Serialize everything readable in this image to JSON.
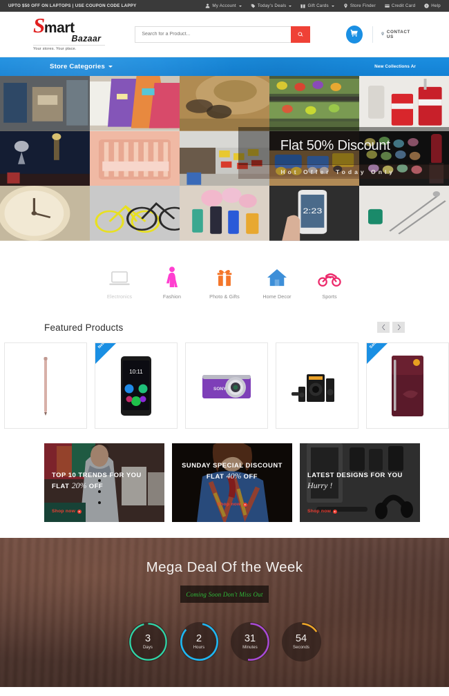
{
  "topbar": {
    "promo": "UPTO $50 OFF ON LAPTOPS | USE COUPON CODE LAPPY",
    "items": [
      {
        "label": "My Account",
        "icon": "user-icon",
        "caret": true
      },
      {
        "label": "Today's Deals",
        "icon": "tag-icon",
        "caret": true
      },
      {
        "label": "Gift Cards",
        "icon": "gift-icon",
        "caret": true
      },
      {
        "label": "Store Finder",
        "icon": "location-pin-icon",
        "caret": false
      },
      {
        "label": "Credit Card",
        "icon": "credit-card-icon",
        "caret": false
      },
      {
        "label": "Help",
        "icon": "help-circle-icon",
        "caret": false
      }
    ]
  },
  "header": {
    "logo": {
      "letter": "S",
      "main": "mart",
      "sub": "Bazaar",
      "tagline": "Your stores. Your place."
    },
    "search": {
      "placeholder": "Search for a Product...",
      "value": "",
      "button_icon": "search-icon"
    },
    "cart_icon": "shopping-cart-icon",
    "contact_label": "CONTACT US",
    "contact_icon": "location-pin-icon",
    "accent_red": "#ef4136",
    "accent_blue": "#1a8fe3"
  },
  "nav": {
    "store_categories": "Store Categories",
    "chevron_icon": "chevron-down-icon",
    "right_link": "New Collections Ar",
    "bg_color": "#1b8ee0"
  },
  "hero": {
    "title": "Flat 50% Discount",
    "subtitle": "Hot Offer Today Only",
    "tiles": [
      "storefront-photo",
      "handbags-photo",
      "sunglasses-hat-photo",
      "produce-shelf-photo",
      "cola-drink-photo",
      "jewelry-dark-photo",
      "baby-crib-photo",
      "supermarket-aisle-photo",
      "toy-train-photo",
      "makeup-palette-photo",
      "clock-photo",
      "bicycles-photo",
      "perfume-bottles-photo",
      "smartphone-hand-photo",
      "pens-desk-photo"
    ]
  },
  "categories": {
    "items": [
      {
        "label": "Electronics",
        "icon": "laptop-icon",
        "color": "#d2d2d2",
        "dim": true
      },
      {
        "label": "Fashion",
        "icon": "woman-dress-icon",
        "color": "#ff3fd0",
        "dim": false
      },
      {
        "label": "Photo & Gifts",
        "icon": "gift-box-icon",
        "color": "#f4762a",
        "dim": false
      },
      {
        "label": "Home Decor",
        "icon": "house-icon",
        "color": "#3d8fd8",
        "dim": false
      },
      {
        "label": "Sports",
        "icon": "motorcycle-icon",
        "color": "#ec2a6b",
        "dim": false
      }
    ]
  },
  "featured": {
    "title": "Featured Products",
    "prev_icon": "chevron-left-icon",
    "next_icon": "chevron-right-icon",
    "products": [
      {
        "name": "rose-gold-stylus",
        "badge": "",
        "image": "stylus-pen-product"
      },
      {
        "name": "black-smartphone",
        "badge": "New",
        "image": "smartphone-product"
      },
      {
        "name": "purple-sony-camera",
        "badge": "",
        "image": "camera-product"
      },
      {
        "name": "speaker-system",
        "badge": "",
        "image": "speakers-product"
      },
      {
        "name": "maroon-refrigerator",
        "badge": "Sale",
        "image": "refrigerator-product"
      }
    ],
    "badge_color": "#1a8fe3"
  },
  "promos": [
    {
      "name": "top-trends",
      "line1": "TOP 10 TRENDS FOR YOU",
      "line2_pre": "FLAT ",
      "line2_script": "20%",
      "line2_post": " OFF",
      "cta": "Shop now",
      "image": "woman-shopping-bags-photo"
    },
    {
      "name": "sunday-special",
      "line1": "SUNDAY SPECIAL DISCOUNT",
      "line2_pre": "FLAT ",
      "line2_script": "40%",
      "line2_post": " OFF",
      "cta": "Shop now",
      "image": "woman-scarf-photo"
    },
    {
      "name": "latest-designs",
      "line1": "LATEST DESIGNS FOR YOU",
      "line2_pre": "",
      "line2_script": "Hurry !",
      "line2_post": "",
      "cta": "Shop now",
      "image": "electronics-headphones-photo"
    }
  ],
  "mega": {
    "title": "Mega Deal Of the Week",
    "badge": "Coming Soon Don't Miss Out",
    "badge_color": "#2fbd3a",
    "countdown": [
      {
        "value": "3",
        "label": "Days",
        "ring_color": "#2fd6a8",
        "pct": 96
      },
      {
        "value": "2",
        "label": "Hours",
        "ring_color": "#1fb6f0",
        "pct": 84
      },
      {
        "value": "31",
        "label": "Minutes",
        "ring_color": "#a84ad6",
        "pct": 52
      },
      {
        "value": "54",
        "label": "Seconds",
        "ring_color": "#f0a828",
        "pct": 15
      }
    ]
  }
}
